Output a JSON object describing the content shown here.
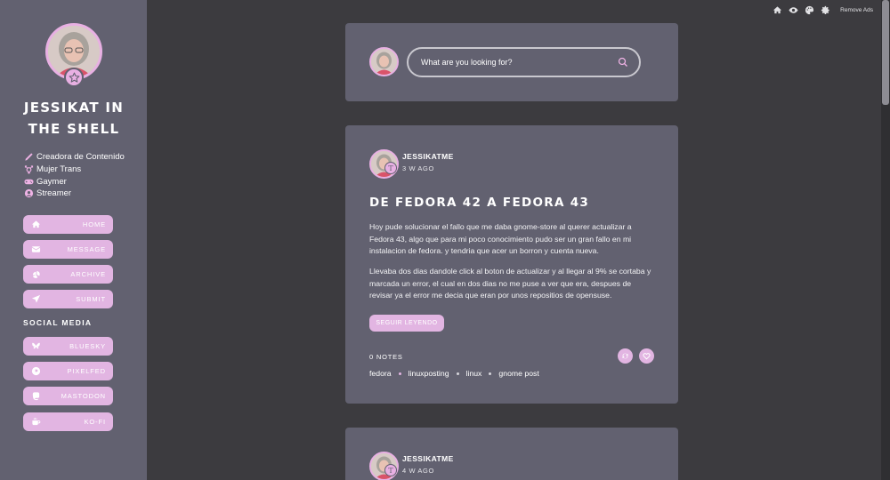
{
  "topnav": {
    "remove_ads": "Remove Ads"
  },
  "sidebar": {
    "title": "JESSIKAT IN THE SHELL",
    "bio": [
      {
        "icon": "pencil-icon",
        "text": "Creadora de Contenido"
      },
      {
        "icon": "transgender-icon",
        "text": "Mujer Trans"
      },
      {
        "icon": "gamepad-icon",
        "text": "Gaymer"
      },
      {
        "icon": "streamer-icon",
        "text": "Streamer"
      }
    ],
    "nav": [
      {
        "label": "HOME",
        "icon": "home-icon"
      },
      {
        "label": "MESSAGE",
        "icon": "mail-icon"
      },
      {
        "label": "ARCHIVE",
        "icon": "archive-icon"
      },
      {
        "label": "SUBMIT",
        "icon": "send-icon"
      }
    ],
    "social_heading": "SOCIAL MEDIA",
    "social": [
      {
        "label": "BLUESKY",
        "icon": "bluesky-icon"
      },
      {
        "label": "PIXELFED",
        "icon": "pixelfed-icon"
      },
      {
        "label": "MASTODON",
        "icon": "mastodon-icon"
      },
      {
        "label": "KO-FI",
        "icon": "kofi-icon"
      }
    ]
  },
  "search": {
    "placeholder": "What are you looking for?"
  },
  "posts": [
    {
      "author": "JESSIKATME",
      "ago": "3 W AGO",
      "title": "DE FEDORA 42 A FEDORA 43",
      "paragraphs": [
        "Hoy pude solucionar el fallo que me daba gnome-store al querer actualizar a Fedora 43, algo que para mi poco conocimiento pudo ser un gran fallo en mi instalacion de fedora. y tendria que acer un borron y cuenta nueva.",
        "Llevaba dos dias dandole click al boton de actualizar y al llegar al 9% se cortaba y marcada un error, el cual en dos dias no me puse a ver que era, despues de revisar ya el error me decia que eran por unos repositios de opensuse."
      ],
      "read_more": "SEGUIR LEYENDO",
      "notes": "0 NOTES",
      "tags": [
        "fedora",
        "linuxposting",
        "linux",
        "gnome post"
      ]
    },
    {
      "author": "JESSIKATME",
      "ago": "4 W AGO"
    }
  ],
  "colors": {
    "accent": "#e2b5e2",
    "sidebar": "#626170",
    "background": "#3c3b3f",
    "card": "#626170"
  }
}
